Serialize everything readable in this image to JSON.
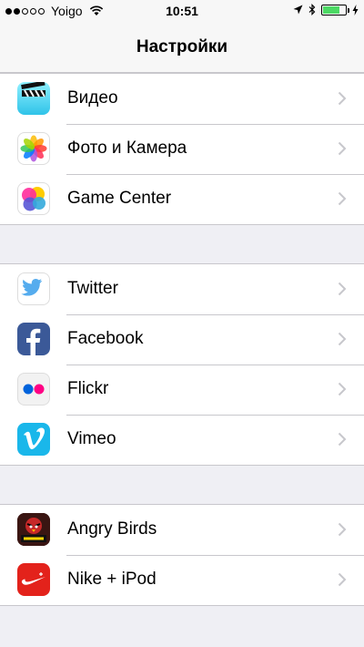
{
  "status_bar": {
    "carrier": "Yoigo",
    "time": "10:51",
    "signal_bars_filled": 2,
    "signal_bars_total": 5,
    "battery_level": 0.75
  },
  "nav": {
    "title": "Настройки"
  },
  "groups": [
    {
      "items": [
        {
          "label": "Видео",
          "icon": "video-icon"
        },
        {
          "label": "Фото и Камера",
          "icon": "photos-camera-icon"
        },
        {
          "label": "Game Center",
          "icon": "game-center-icon"
        }
      ]
    },
    {
      "items": [
        {
          "label": "Twitter",
          "icon": "twitter-icon"
        },
        {
          "label": "Facebook",
          "icon": "facebook-icon"
        },
        {
          "label": "Flickr",
          "icon": "flickr-icon"
        },
        {
          "label": "Vimeo",
          "icon": "vimeo-icon"
        }
      ]
    },
    {
      "items": [
        {
          "label": "Angry Birds",
          "icon": "angry-birds-icon"
        },
        {
          "label": "Nike + iPod",
          "icon": "nike-ipod-icon"
        }
      ]
    }
  ],
  "colors": {
    "background": "#efeff4",
    "separator": "#c8c7cc",
    "battery": "#4cd964",
    "chevron": "#c7c7cc"
  }
}
